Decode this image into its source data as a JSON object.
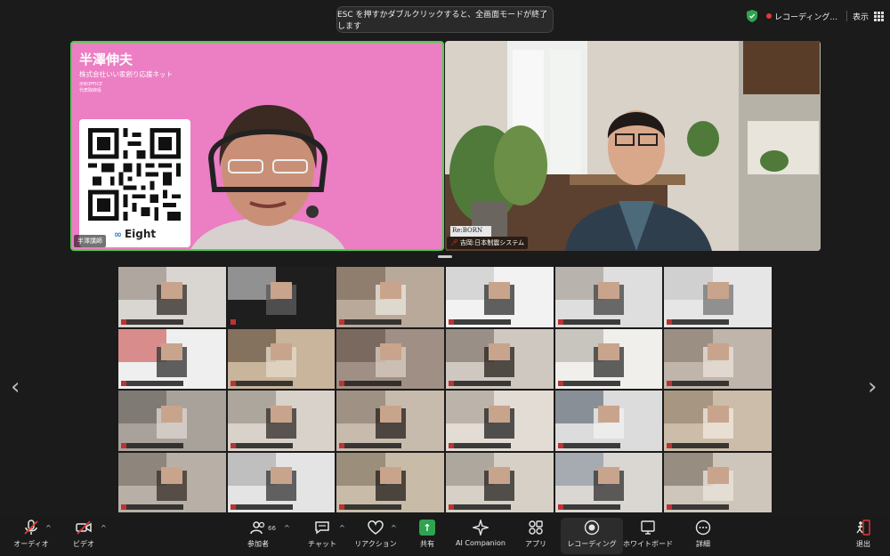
{
  "esc_banner": "ESC を押すかダブルクリックすると、全画面モードが終了します",
  "top_right": {
    "recording_label": "レコーディング...",
    "view_label": "表示"
  },
  "speakers": {
    "left": {
      "name_tag": "半澤講師",
      "title": "半澤伸夫",
      "subtitle": "株式会社いい家創り応援ネット",
      "small1": "示BOFFICE",
      "small2": "代表取締役",
      "qr_brand": "Eight"
    },
    "right": {
      "name_tag": "吉岡:日本制震システム",
      "logo_text": "Re:BORN"
    }
  },
  "navigation": {
    "prev_arrow": "‹",
    "next_arrow": "›"
  },
  "toolbar": {
    "audio": "オーディオ",
    "video": "ビデオ",
    "participants": "参加者",
    "participants_count": "66",
    "chat": "チャット",
    "reaction": "リアクション",
    "share": "共有",
    "ai_companion": "AI Companion",
    "apps": "アプリ",
    "recording": "レコーディング",
    "whiteboard": "ホワイトボード",
    "details": "詳細",
    "leave": "退出",
    "caret": "^"
  },
  "colors": {
    "active_speaker_border": "#4ad04a",
    "share_green": "#2ea44f",
    "recording_red": "#e53935"
  }
}
